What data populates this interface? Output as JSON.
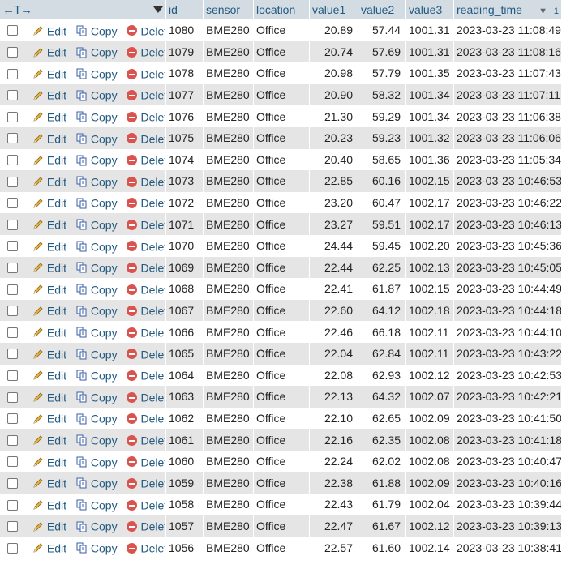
{
  "header": {
    "nav_arrows": "←T→",
    "columns": [
      "id",
      "sensor",
      "location",
      "value1",
      "value2",
      "value3",
      "reading_time"
    ],
    "sort_indicator": "▼",
    "sort_number": "1"
  },
  "actions": {
    "edit": "Edit",
    "copy": "Copy",
    "delete": "Delete"
  },
  "rows": [
    {
      "id": "1080",
      "sensor": "BME280",
      "location": "Office",
      "value1": "20.89",
      "value2": "57.44",
      "value3": "1001.31",
      "reading_time": "2023-03-23 11:08:49"
    },
    {
      "id": "1079",
      "sensor": "BME280",
      "location": "Office",
      "value1": "20.74",
      "value2": "57.69",
      "value3": "1001.31",
      "reading_time": "2023-03-23 11:08:16"
    },
    {
      "id": "1078",
      "sensor": "BME280",
      "location": "Office",
      "value1": "20.98",
      "value2": "57.79",
      "value3": "1001.35",
      "reading_time": "2023-03-23 11:07:43"
    },
    {
      "id": "1077",
      "sensor": "BME280",
      "location": "Office",
      "value1": "20.90",
      "value2": "58.32",
      "value3": "1001.34",
      "reading_time": "2023-03-23 11:07:11"
    },
    {
      "id": "1076",
      "sensor": "BME280",
      "location": "Office",
      "value1": "21.30",
      "value2": "59.29",
      "value3": "1001.34",
      "reading_time": "2023-03-23 11:06:38"
    },
    {
      "id": "1075",
      "sensor": "BME280",
      "location": "Office",
      "value1": "20.23",
      "value2": "59.23",
      "value3": "1001.32",
      "reading_time": "2023-03-23 11:06:06"
    },
    {
      "id": "1074",
      "sensor": "BME280",
      "location": "Office",
      "value1": "20.40",
      "value2": "58.65",
      "value3": "1001.36",
      "reading_time": "2023-03-23 11:05:34"
    },
    {
      "id": "1073",
      "sensor": "BME280",
      "location": "Office",
      "value1": "22.85",
      "value2": "60.16",
      "value3": "1002.15",
      "reading_time": "2023-03-23 10:46:53"
    },
    {
      "id": "1072",
      "sensor": "BME280",
      "location": "Office",
      "value1": "23.20",
      "value2": "60.47",
      "value3": "1002.17",
      "reading_time": "2023-03-23 10:46:22"
    },
    {
      "id": "1071",
      "sensor": "BME280",
      "location": "Office",
      "value1": "23.27",
      "value2": "59.51",
      "value3": "1002.17",
      "reading_time": "2023-03-23 10:46:13"
    },
    {
      "id": "1070",
      "sensor": "BME280",
      "location": "Office",
      "value1": "24.44",
      "value2": "59.45",
      "value3": "1002.20",
      "reading_time": "2023-03-23 10:45:36"
    },
    {
      "id": "1069",
      "sensor": "BME280",
      "location": "Office",
      "value1": "22.44",
      "value2": "62.25",
      "value3": "1002.13",
      "reading_time": "2023-03-23 10:45:05"
    },
    {
      "id": "1068",
      "sensor": "BME280",
      "location": "Office",
      "value1": "22.41",
      "value2": "61.87",
      "value3": "1002.15",
      "reading_time": "2023-03-23 10:44:49"
    },
    {
      "id": "1067",
      "sensor": "BME280",
      "location": "Office",
      "value1": "22.60",
      "value2": "64.12",
      "value3": "1002.18",
      "reading_time": "2023-03-23 10:44:18"
    },
    {
      "id": "1066",
      "sensor": "BME280",
      "location": "Office",
      "value1": "22.46",
      "value2": "66.18",
      "value3": "1002.11",
      "reading_time": "2023-03-23 10:44:10"
    },
    {
      "id": "1065",
      "sensor": "BME280",
      "location": "Office",
      "value1": "22.04",
      "value2": "62.84",
      "value3": "1002.11",
      "reading_time": "2023-03-23 10:43:22"
    },
    {
      "id": "1064",
      "sensor": "BME280",
      "location": "Office",
      "value1": "22.08",
      "value2": "62.93",
      "value3": "1002.12",
      "reading_time": "2023-03-23 10:42:53"
    },
    {
      "id": "1063",
      "sensor": "BME280",
      "location": "Office",
      "value1": "22.13",
      "value2": "64.32",
      "value3": "1002.07",
      "reading_time": "2023-03-23 10:42:21"
    },
    {
      "id": "1062",
      "sensor": "BME280",
      "location": "Office",
      "value1": "22.10",
      "value2": "62.65",
      "value3": "1002.09",
      "reading_time": "2023-03-23 10:41:50"
    },
    {
      "id": "1061",
      "sensor": "BME280",
      "location": "Office",
      "value1": "22.16",
      "value2": "62.35",
      "value3": "1002.08",
      "reading_time": "2023-03-23 10:41:18"
    },
    {
      "id": "1060",
      "sensor": "BME280",
      "location": "Office",
      "value1": "22.24",
      "value2": "62.02",
      "value3": "1002.08",
      "reading_time": "2023-03-23 10:40:47"
    },
    {
      "id": "1059",
      "sensor": "BME280",
      "location": "Office",
      "value1": "22.38",
      "value2": "61.88",
      "value3": "1002.09",
      "reading_time": "2023-03-23 10:40:16"
    },
    {
      "id": "1058",
      "sensor": "BME280",
      "location": "Office",
      "value1": "22.43",
      "value2": "61.79",
      "value3": "1002.04",
      "reading_time": "2023-03-23 10:39:44"
    },
    {
      "id": "1057",
      "sensor": "BME280",
      "location": "Office",
      "value1": "22.47",
      "value2": "61.67",
      "value3": "1002.12",
      "reading_time": "2023-03-23 10:39:13"
    },
    {
      "id": "1056",
      "sensor": "BME280",
      "location": "Office",
      "value1": "22.57",
      "value2": "61.60",
      "value3": "1002.14",
      "reading_time": "2023-03-23 10:38:41"
    }
  ]
}
